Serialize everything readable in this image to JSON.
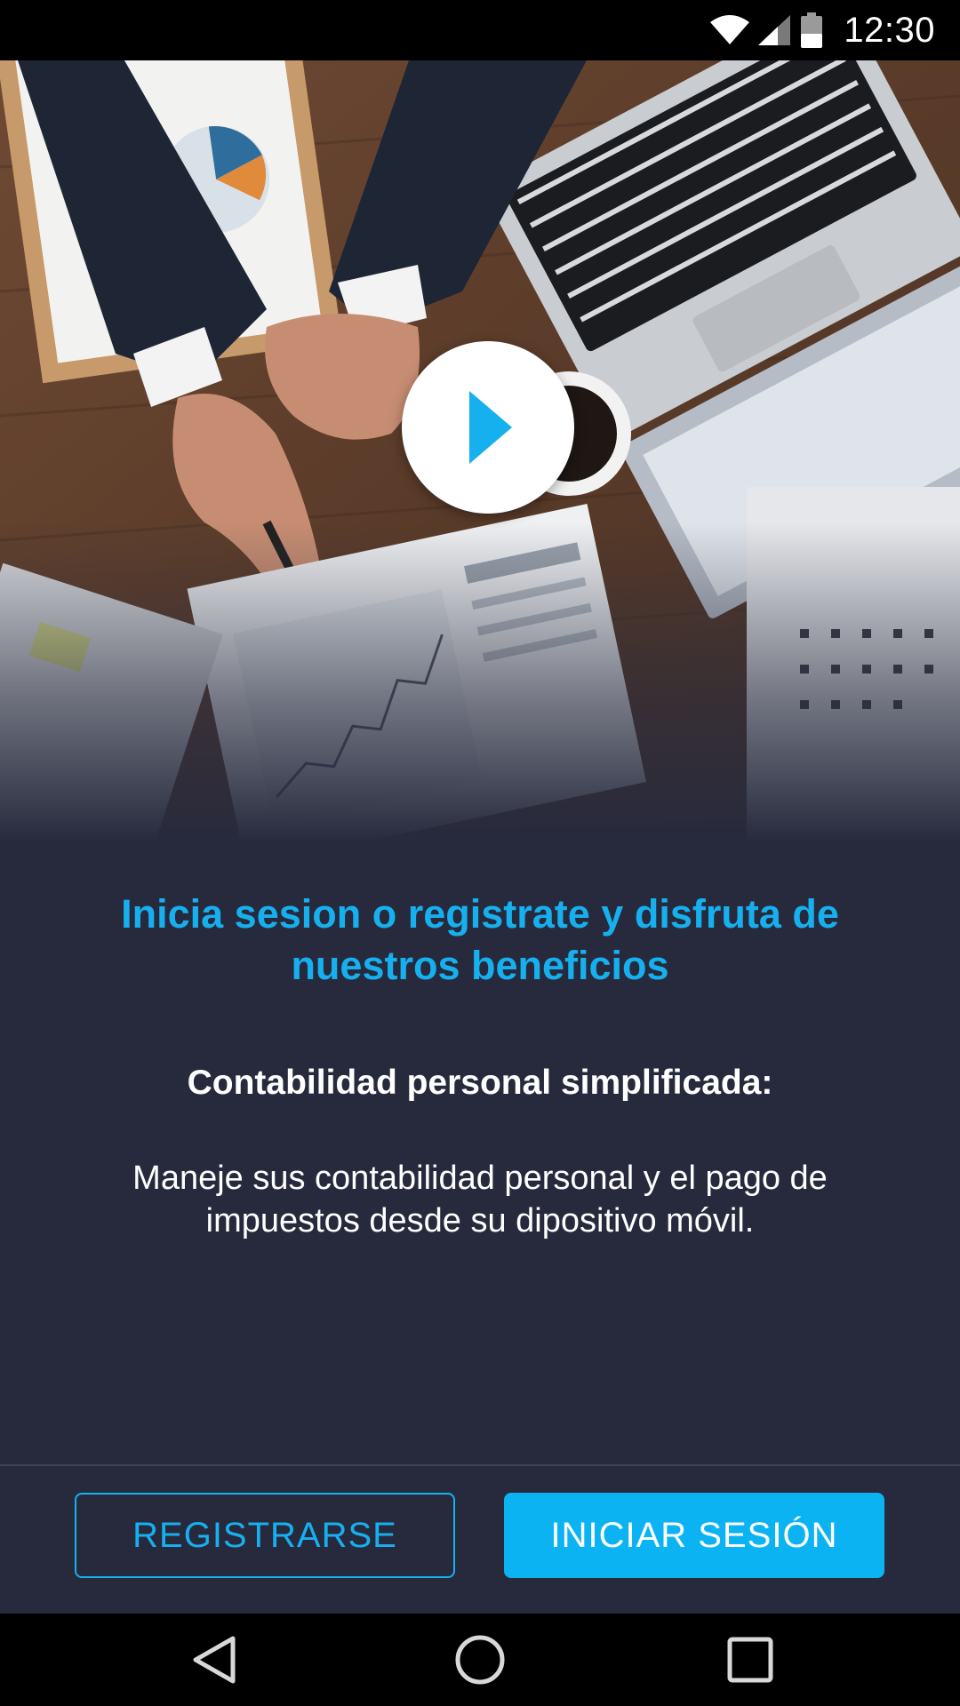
{
  "status_bar": {
    "time": "12:30",
    "icons": [
      "wifi-icon",
      "signal-icon",
      "battery-icon"
    ]
  },
  "hero": {
    "description_icon": "play-icon",
    "accent": "#16b0ef"
  },
  "content": {
    "headline": "Inicia sesion o registrate y disfruta de nuestros beneficios",
    "subtitle": "Contabilidad personal simplificada:",
    "description": "Maneje sus contabilidad personal y el pago de impuestos desde su dipositivo móvil."
  },
  "actions": {
    "register_label": "REGISTRARSE",
    "login_label": "INICIAR SESIÓN"
  },
  "nav_bar": {
    "icons": [
      "back-icon",
      "home-icon",
      "recents-icon"
    ]
  },
  "colors": {
    "background": "#272a3d",
    "accent": "#16b0ef",
    "primary_button": "#0bb3f2"
  }
}
